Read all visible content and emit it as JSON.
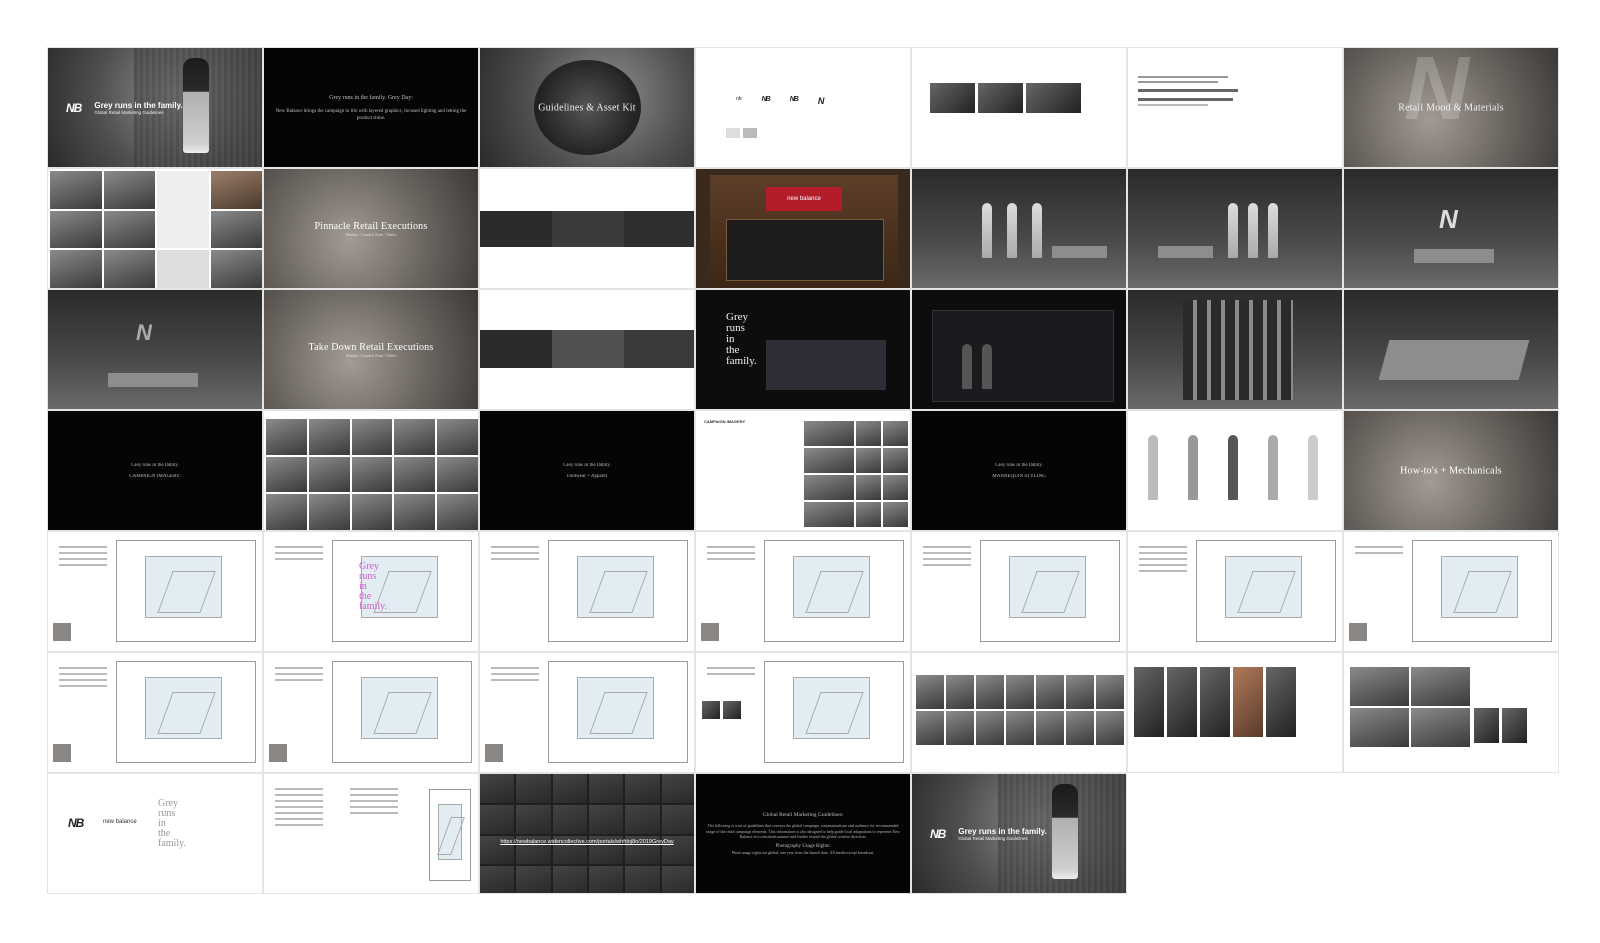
{
  "slides": {
    "cover_tagline": "Grey runs in the family.",
    "cover_subtitle": "Global Retail Marketing Guidelines",
    "intro_title": "Grey runs in the family. Grey Day:",
    "intro_body": "New Balance brings the campaign to life with layered graphics, focused lighting and letting the product shine.",
    "guidelines_title": "Guidelines & Asset Kit",
    "retail_mood_title": "Retail Mood & Materials",
    "pinnacle_title": "Pinnacle Retail Executions",
    "pinnacle_sub": "Window / Launch Zone / Tables",
    "store_sign": "new balance",
    "window_grey_lines": [
      "Grey",
      "runs",
      "in",
      "the",
      "family."
    ],
    "take_down_title": "Take Down Retail Executions",
    "take_down_sub": "Window / Launch Zone / Tables",
    "campaign_imagery_line1": "Grey runs in the family.",
    "campaign_imagery_line2": "CAMPAIGN IMAGERY:",
    "footwear_apparel_line1": "Grey runs in the family.",
    "footwear_apparel_line2": "Footwear + Apparel",
    "campaign_imagery_list_title": "CAMPAIGN IMAGERY",
    "mannequin_line1": "Grey runs in the family.",
    "mannequin_line2": "MANNEQUIN STYLING",
    "howtos_title": "How-to's + Mechanicals",
    "closing_brand": "new balance",
    "closing_lines": [
      "Grey",
      "runs",
      "in",
      "the",
      "family."
    ],
    "download_link": "https://newbalance.widencollective.com/portals/whfdoj8o/2019GreyDay",
    "global_title": "Global Retail Marketing Guidelines:",
    "global_body": "The following is a set of guidelines that conveys the global campaign, communications and audience for recommended usage of the retail campaign elements. This information is also designed to help guide local adaptations to represent New Balance in a consistent manner and further extend the global creative direction.",
    "photo_rights_title": "Photography Usage Rights:",
    "photo_rights_body": "Photo usage rights are global, one year from the launch date. All media except broadcast.",
    "end_tagline": "Grey runs in the family.",
    "end_subtitle": "Global Retail Marketing Guidelines"
  }
}
